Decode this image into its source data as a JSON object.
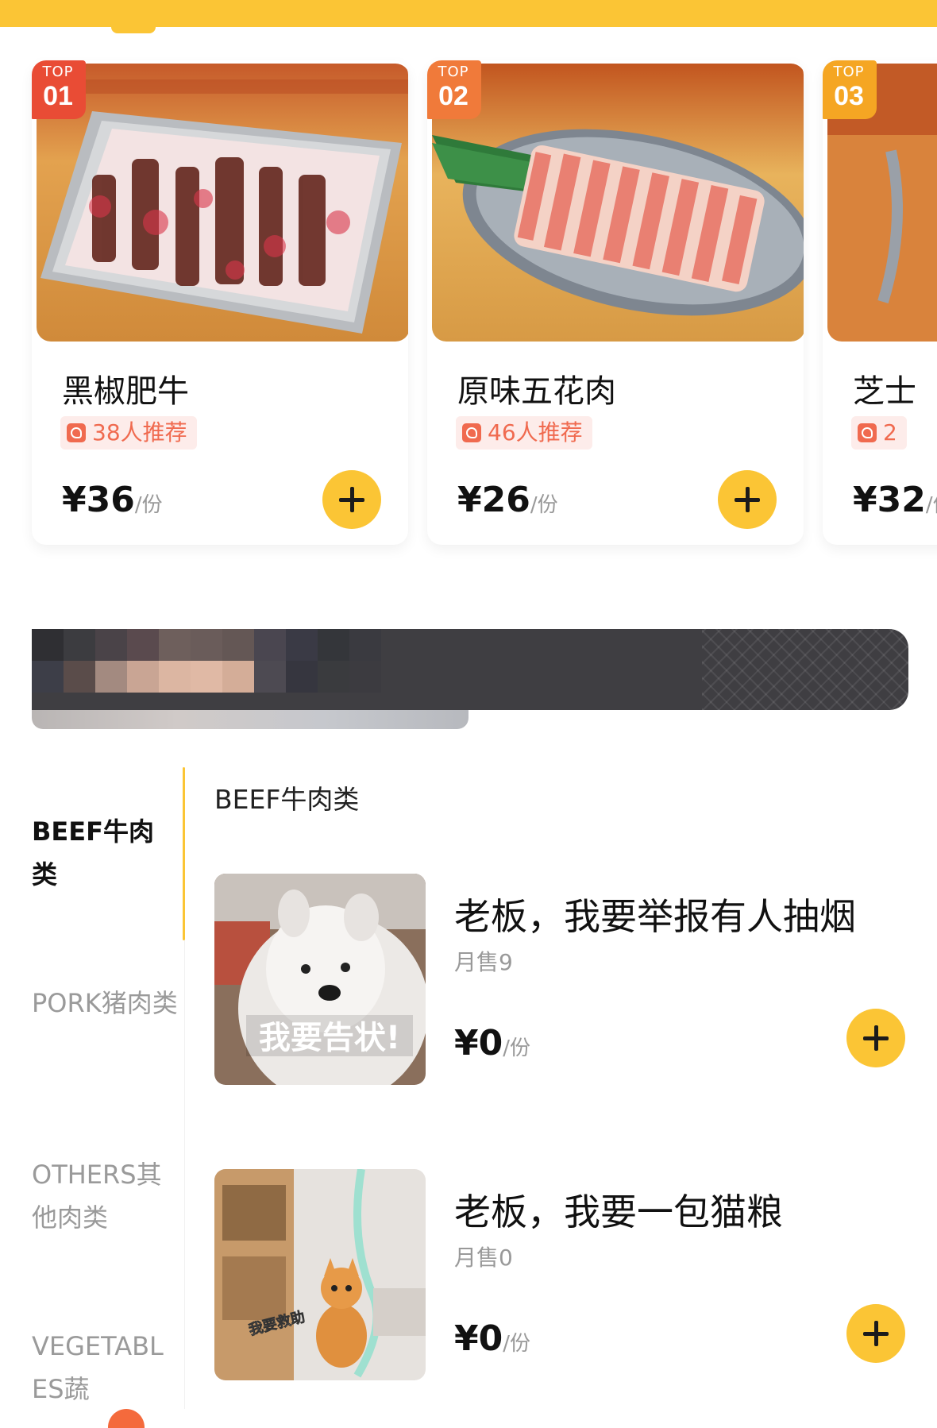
{
  "top_list": [
    {
      "badge_top": "TOP",
      "badge_num": "01",
      "badge_color": "#e94c35",
      "name": "黑椒肥牛",
      "rec": "38人推荐",
      "price": "¥36",
      "unit": "/份"
    },
    {
      "badge_top": "TOP",
      "badge_num": "02",
      "badge_color": "#f07a3a",
      "name": "原味五花肉",
      "rec": "46人推荐",
      "price": "¥26",
      "unit": "/份"
    },
    {
      "badge_top": "TOP",
      "badge_num": "03",
      "badge_color": "#f5a623",
      "name": "芝士",
      "rec": "2",
      "price": "¥32",
      "unit": "/份"
    }
  ],
  "categories": [
    {
      "label": "BEEF牛肉类",
      "active": true
    },
    {
      "label": "PORK猪肉类",
      "active": false
    },
    {
      "label": "OTHERS其他肉类",
      "active": false
    },
    {
      "label": "VEGETABLES蔬",
      "active": false
    }
  ],
  "section_title": "BEEF牛肉类",
  "items": [
    {
      "title": "老板，我要举报有人抽烟",
      "sales": "月售9",
      "price": "¥0",
      "unit": "/份",
      "image_caption": "我要告状!"
    },
    {
      "title": "老板，我要一包猫粮",
      "sales": "月售0",
      "price": "¥0",
      "unit": "/份",
      "image_caption": "我要救助"
    }
  ],
  "colors": {
    "accent": "#fbc535",
    "recommend": "#f06a4f"
  },
  "icons": [
    "plus-icon",
    "recommend-icon"
  ]
}
